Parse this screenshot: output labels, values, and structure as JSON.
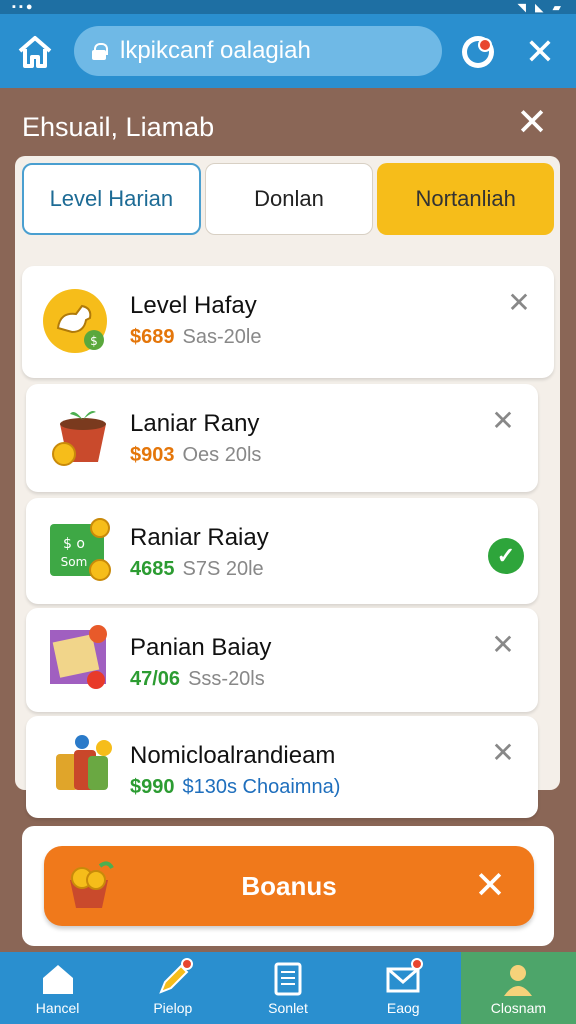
{
  "app": {
    "url": "lkpikcanf oalagiah"
  },
  "dialog": {
    "title": "Ehsuail, Liamab"
  },
  "tabs": [
    {
      "label": "Level Harian",
      "state": "outlined"
    },
    {
      "label": "Donlan",
      "state": "plain"
    },
    {
      "label": "Nortanliah",
      "state": "highlighted"
    }
  ],
  "items": [
    {
      "name": "Level Hafay",
      "price": "$689",
      "extra": "Sas-20le",
      "price_color": "#e4760a",
      "icon": "duck-coin-icon",
      "status": "dismissible"
    },
    {
      "name": "Laniar Rany",
      "price": "$903",
      "extra": "Oes 20ls",
      "price_color": "#e4760a",
      "icon": "flower-pot-icon",
      "status": "dismissible"
    },
    {
      "name": "Raniar Raiay",
      "price": "4685",
      "extra": "S7S 20le",
      "price_color": "#2c9c32",
      "icon": "cash-coins-icon",
      "status": "checked"
    },
    {
      "name": "Panian Baiay",
      "price": "47/06",
      "extra": "Sss-20ls",
      "price_color": "#2c9c32",
      "icon": "ticket-fruit-icon",
      "status": "dismissible"
    },
    {
      "name": "Nomicloalrandieam",
      "price": "$990",
      "extra": "$130s Choaimna)",
      "price_color": "#2c9c32",
      "extra_color": "#1f6fbd",
      "icon": "treasure-bundle-icon",
      "status": "dismissible"
    }
  ],
  "bonus": {
    "label": "Boanus"
  },
  "nav": [
    {
      "label": "Hancel",
      "icon": "home-icon"
    },
    {
      "label": "Pielop",
      "icon": "pencil-icon"
    },
    {
      "label": "Sonlet",
      "icon": "document-icon"
    },
    {
      "label": "Eaog",
      "icon": "mail-icon"
    },
    {
      "label": "Closnam",
      "icon": "person-icon",
      "active": true
    }
  ],
  "colors": {
    "top_bar": "#2a8fcf",
    "highlight_tab": "#f6bd1a",
    "bonus_button": "#f0791b",
    "active_nav": "#4da56a"
  }
}
